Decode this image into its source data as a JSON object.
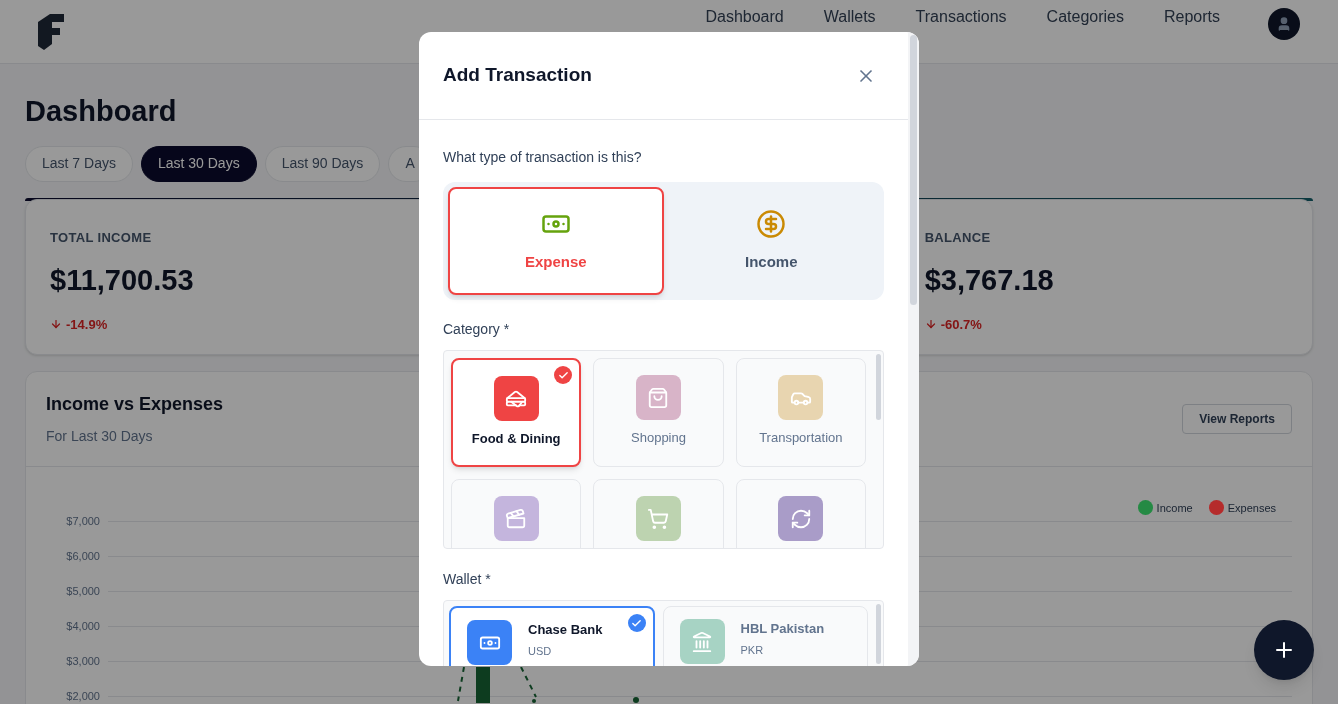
{
  "header": {
    "nav": [
      "Dashboard",
      "Wallets",
      "Transactions",
      "Categories",
      "Reports"
    ]
  },
  "page": {
    "title": "Dashboard",
    "ranges": [
      {
        "label": "Last 7 Days",
        "selected": false
      },
      {
        "label": "Last 30 Days",
        "selected": true
      },
      {
        "label": "Last 90 Days",
        "selected": false
      },
      {
        "label": "A",
        "selected": false
      }
    ]
  },
  "stats": [
    {
      "label": "TOTAL INCOME",
      "value": "$11,700.53",
      "change": "-14.9%"
    },
    {
      "label": "BALANCE",
      "value": "$3,767.18",
      "change": "-60.7%"
    }
  ],
  "chart": {
    "title": "Income vs Expenses",
    "subtitle": "For Last 30 Days",
    "button": "View Reports",
    "legend": [
      {
        "label": "Income",
        "color": "#258a44"
      },
      {
        "label": "Expenses",
        "color": "#b52b2b"
      }
    ],
    "y_axis_labels": [
      "$7,000",
      "$6,000",
      "$5,000",
      "$4,000",
      "$3,000",
      "$2,000"
    ]
  },
  "modal": {
    "title": "Add Transaction",
    "question": "What type of transaction is this?",
    "types": [
      {
        "label": "Expense",
        "kind": "expense",
        "selected": true
      },
      {
        "label": "Income",
        "kind": "income",
        "selected": false
      }
    ],
    "category_label": "Category *",
    "categories": [
      {
        "label": "Food & Dining",
        "kind": "burger",
        "color": "#ef4444",
        "selected": true
      },
      {
        "label": "Shopping",
        "kind": "bag",
        "color": "#d8b4c8",
        "selected": false
      },
      {
        "label": "Transportation",
        "kind": "car",
        "color": "#e8d5b0",
        "selected": false
      },
      {
        "kind": "clapper",
        "color": "#c4b5dd",
        "selected": false
      },
      {
        "kind": "cart",
        "color": "#bdd3b0",
        "selected": false
      },
      {
        "kind": "refresh",
        "color": "#a99cc8",
        "selected": false
      }
    ],
    "wallet_label": "Wallet *",
    "wallets": [
      {
        "name": "Chase Bank",
        "currency": "USD",
        "kind": "cash",
        "color": "#3b82f6",
        "selected": true
      },
      {
        "name": "HBL Pakistan",
        "currency": "PKR",
        "kind": "bank",
        "color": "#a7d3c4",
        "selected": false
      }
    ]
  }
}
